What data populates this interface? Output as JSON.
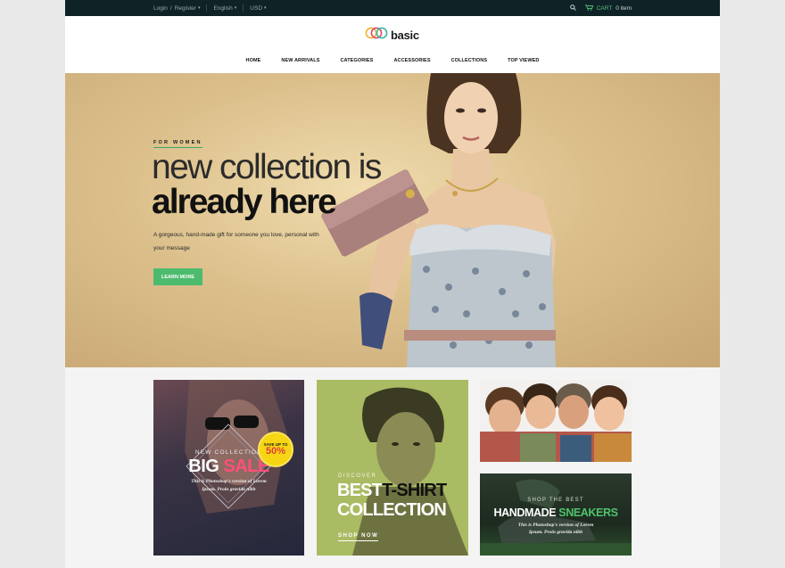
{
  "topbar": {
    "login": "Login",
    "slash": "/",
    "register": "Register",
    "language": "English",
    "currency": "USD",
    "cart_label": "CART",
    "cart_count": "0 item"
  },
  "brand": {
    "name": "basic"
  },
  "nav": [
    "HOME",
    "NEW ARRIVALS",
    "CATEGORIES",
    "ACCESSORIES",
    "COLLECTIONS",
    "TOP VIEWED"
  ],
  "hero": {
    "eyebrow": "FOR WOMEN",
    "title_line1": "new collection is",
    "title_line2": "already here",
    "description": "A gorgeous, hand-made gift for someone you love, personal with your message",
    "button": "LEARN MORE"
  },
  "promo_sale": {
    "subtitle": "NEW COLLECTION",
    "title_a": "BIG",
    "title_b": "SALE",
    "note_line1": "This is Photoshop's version  of Lorem",
    "note_line2": "Ipsum. Proin gravida nibh",
    "badge_top": "SAVE UP TO",
    "badge_value": "50%"
  },
  "promo_tshirt": {
    "subtitle": "DISCOVER",
    "title_a": "BEST",
    "title_b": "T-SHIRT",
    "title_line2": "COLLECTION",
    "link": "SHOP NOW"
  },
  "promo_sneakers": {
    "subtitle": "SHOP THE BEST",
    "title_a": "HANDMADE",
    "title_b": "SNEAKERS",
    "note_line1": "This is Photoshop's version  of Lorem",
    "note_line2": "Ipsum. Proin gravida nibh"
  },
  "colors": {
    "accent": "#4dbb6e",
    "topbar": "#0f2327",
    "sale_pink": "#ff4f7a",
    "badge": "#f5d514"
  },
  "icons": [
    "search-icon",
    "cart-icon",
    "chevron-down-icon",
    "rings-logo-icon"
  ]
}
